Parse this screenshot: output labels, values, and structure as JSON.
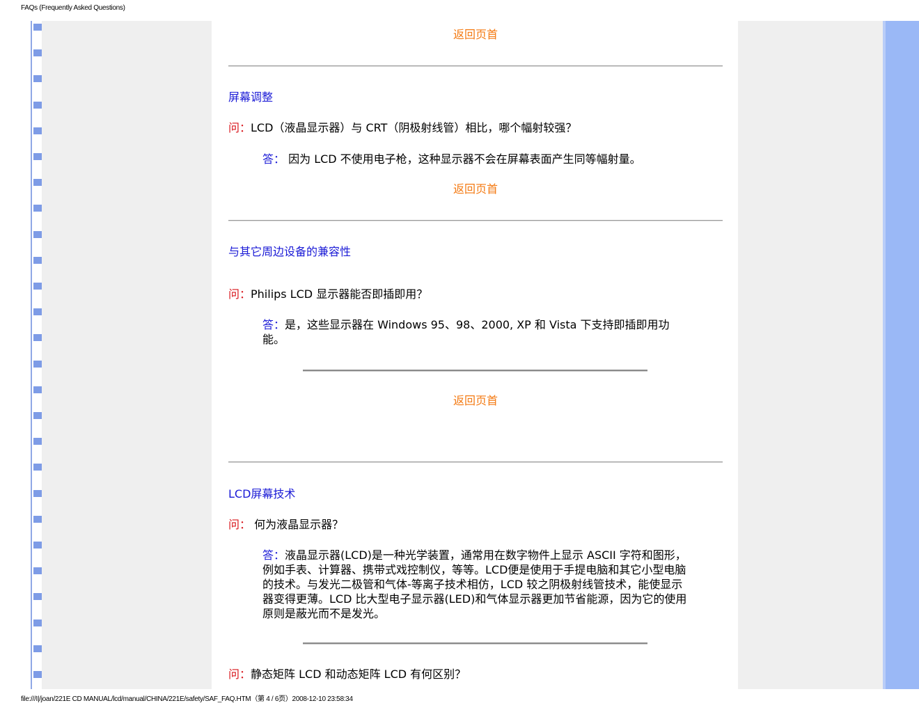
{
  "page_header": "FAQs (Frequently Asked Questions)",
  "page_footer": "file:///I|/joan/221E CD MANUAL/lcd/manual/CHINA/221E/safety/SAF_FAQ.HTM（第 4 / 6页）2008-12-10 23:58:34",
  "back_to_top": "返回页首",
  "sections": [
    {
      "title": "屏幕调整",
      "qa": [
        {
          "q_label": "问：",
          "q_text": "LCD（液晶显示器）与 CRT（阴极射线管）相比，哪个幅射较强？",
          "a_label": "答：",
          "a_text": " 因为 LCD 不使用电子枪，这种显示器不会在屏幕表面产生同等幅射量。"
        }
      ]
    },
    {
      "title": "与其它周边设备的兼容性",
      "qa": [
        {
          "q_label": "问：",
          "q_text": "Philips LCD 显示器能否即插即用？",
          "a_label": "答：",
          "a_text": "是，这些显示器在 Windows 95、98、2000, XP 和 Vista 下支持即插即用功能。"
        }
      ]
    },
    {
      "title": "LCD屏幕技术",
      "qa": [
        {
          "q_label": "问：",
          "q_text": " 何为液晶显示器？",
          "a_label": "答：",
          "a_text": "液晶显示器(LCD)是一种光学装置，通常用在数字物件上显示 ASCII 字符和图形，例如手表、计算器、携带式戏控制仪，等等。LCD便是使用于手提电脑和其它小型电脑的技术。与发光二极管和气体-等离子技术相仿，LCD 较之阴极射线管技术，能使显示器变得更薄。LCD 比大型电子显示器(LED)和气体显示器更加节省能源，因为它的使用原则是蔽光而不是发光。"
        },
        {
          "q_label": "问：",
          "q_text": "静态矩阵 LCD 和动态矩阵 LCD 有何区别？"
        }
      ]
    }
  ]
}
